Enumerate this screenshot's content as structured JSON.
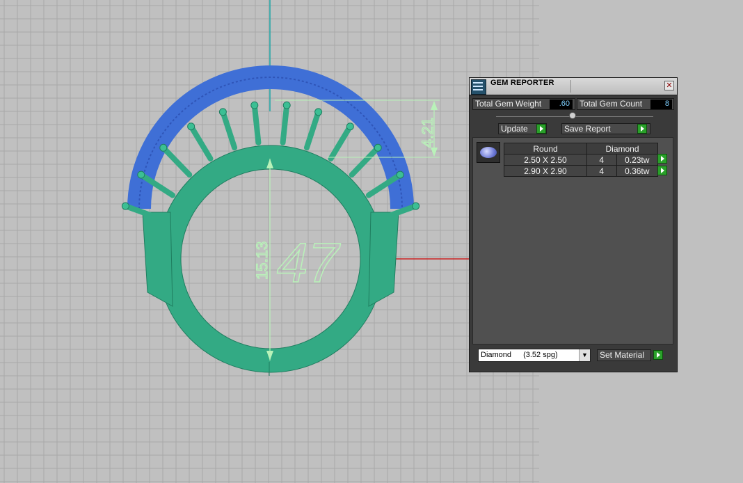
{
  "viewport": {
    "dimension_vertical": "15.13",
    "dimension_top": "4.21",
    "size_text": "47",
    "colors": {
      "background": "#c0c0c0",
      "grid": "#a8a8a8",
      "ring": "#33aa84",
      "gems": "#3f6fd6",
      "dimension": "#b9f2b9",
      "axis_x": "#cc2222",
      "axis_y": "#1aa5a5"
    }
  },
  "panel": {
    "title": "GEM REPORTER",
    "close_icon": "close-icon",
    "total_gem_weight_label": "Total Gem Weight",
    "total_gem_weight_value": ".60",
    "total_gem_count_label": "Total Gem Count",
    "total_gem_count_value": "8",
    "update_label": "Update",
    "save_report_label": "Save Report",
    "table": {
      "headers": [
        "Round",
        "Diamond"
      ],
      "rows": [
        {
          "size": "2.50 X 2.50",
          "count": "4",
          "weight": "0.23tw"
        },
        {
          "size": "2.90 X 2.90",
          "count": "4",
          "weight": "0.36tw"
        }
      ]
    },
    "material_select": {
      "name": "Diamond",
      "spg": "(3.52 spg)"
    },
    "set_material_label": "Set Material",
    "accent": "#2aa02a"
  }
}
